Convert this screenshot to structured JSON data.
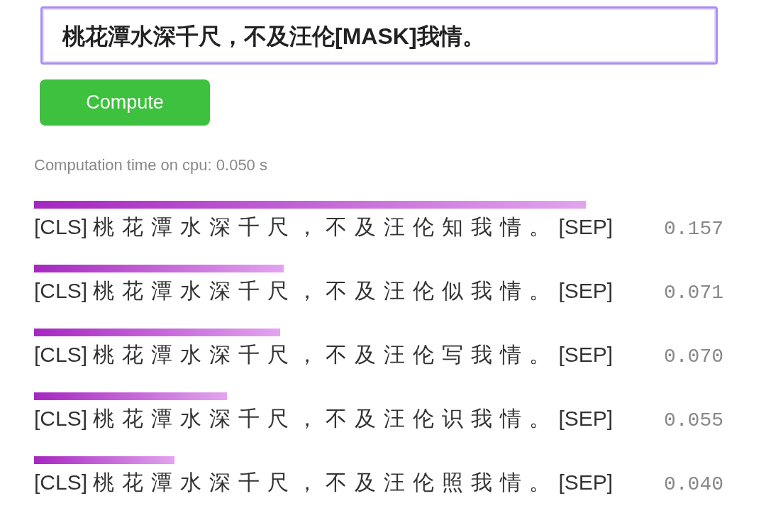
{
  "input": {
    "value": "桃花潭水深千尺，不及汪伦[MASK]我情。"
  },
  "compute_button": "Compute",
  "timing": "Computation time on cpu: 0.050 s",
  "results": [
    {
      "text": "[CLS] 桃花潭水深千尺，不及汪伦知我情。[SEP]",
      "score": "0.157"
    },
    {
      "text": "[CLS] 桃花潭水深千尺，不及汪伦似我情。[SEP]",
      "score": "0.071"
    },
    {
      "text": "[CLS] 桃花潭水深千尺，不及汪伦写我情。[SEP]",
      "score": "0.070"
    },
    {
      "text": "[CLS] 桃花潭水深千尺，不及汪伦识我情。[SEP]",
      "score": "0.055"
    },
    {
      "text": "[CLS] 桃花潭水深千尺，不及汪伦照我情。[SEP]",
      "score": "0.040"
    }
  ]
}
